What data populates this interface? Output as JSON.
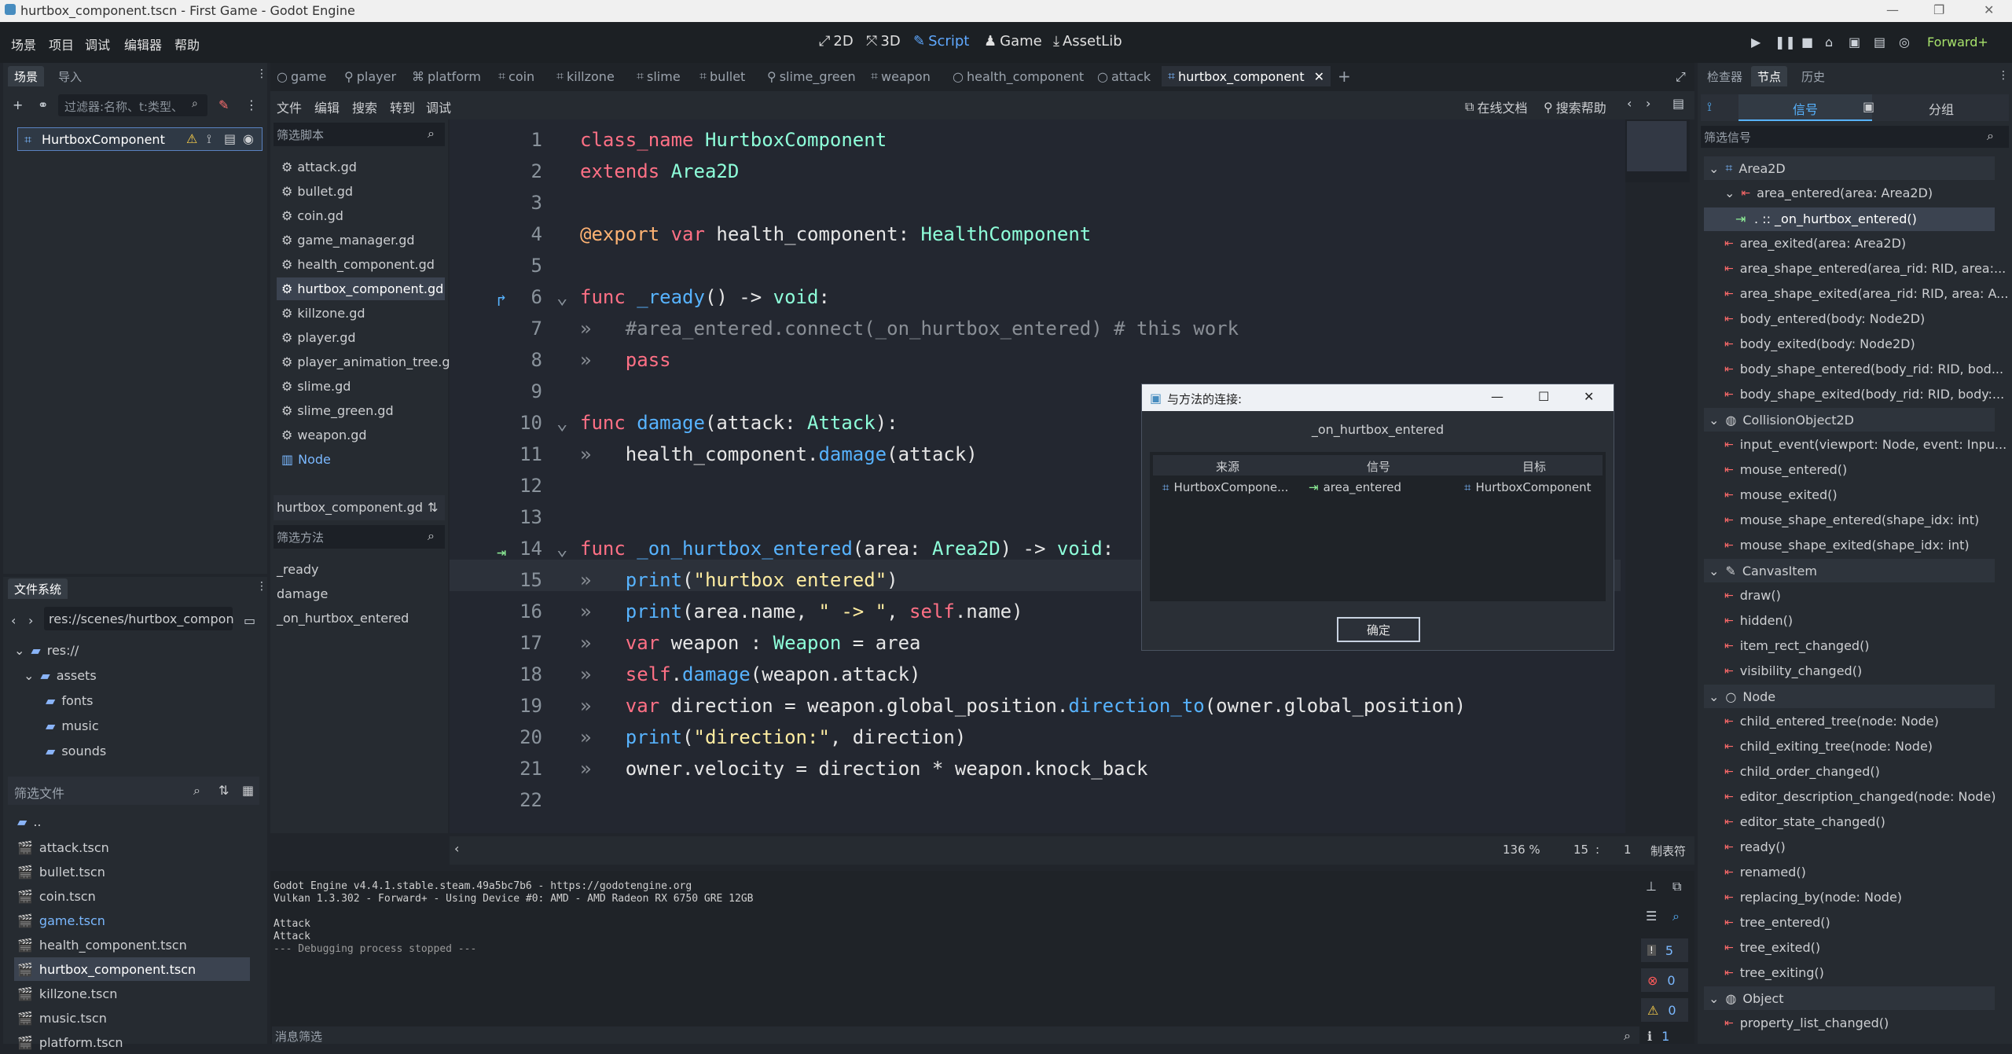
{
  "window": {
    "title": "hurtbox_component.tscn - First Game - Godot Engine"
  },
  "menu": [
    "场景",
    "项目",
    "调试",
    "编辑器",
    "帮助"
  ],
  "workspaces": {
    "w2d": "2D",
    "w3d": "3D",
    "script": "Script",
    "game": "Game",
    "assetlib": "AssetLib"
  },
  "renderer": "Forward+",
  "scene_dock": {
    "tabs": [
      "场景",
      "导入"
    ],
    "filter_placeholder": "过滤器:名称、t:类型、",
    "root_node": "HurtboxComponent"
  },
  "filesystem": {
    "tab": "文件系统",
    "path": "res://scenes/hurtbox_compon",
    "tree": {
      "root": "res://",
      "assets": "assets",
      "fonts": "fonts",
      "music": "music",
      "sounds": "sounds"
    },
    "filter_placeholder": "筛选文件",
    "files": [
      "..",
      "attack.tscn",
      "bullet.tscn",
      "coin.tscn",
      "game.tscn",
      "health_component.tscn",
      "hurtbox_component.tscn",
      "killzone.tscn",
      "music.tscn",
      "platform.tscn"
    ]
  },
  "editor_tabs": [
    "game",
    "player",
    "platform",
    "coin",
    "killzone",
    "slime",
    "bullet",
    "slime_green",
    "weapon",
    "health_component",
    "attack",
    "hurtbox_component"
  ],
  "script_menu": {
    "file": "文件",
    "edit": "编辑",
    "search": "搜索",
    "goto": "转到",
    "debug": "调试",
    "online_docs": "在线文档",
    "search_help": "搜索帮助"
  },
  "script_list": {
    "filter_placeholder": "筛选脚本",
    "items": [
      "attack.gd",
      "bullet.gd",
      "coin.gd",
      "game_manager.gd",
      "health_component.gd",
      "hurtbox_component.gd",
      "killzone.gd",
      "player.gd",
      "player_animation_tree.gd",
      "slime.gd",
      "slime_green.gd",
      "weapon.gd",
      "Node"
    ],
    "current": "hurtbox_component.gd",
    "method_filter": "筛选方法",
    "methods": [
      "_ready",
      "damage",
      "_on_hurtbox_entered"
    ]
  },
  "code": {
    "lines": [
      "1",
      "2",
      "3",
      "4",
      "5",
      "6",
      "7",
      "8",
      "9",
      "10",
      "11",
      "12",
      "13",
      "14",
      "15",
      "16",
      "17",
      "18",
      "19",
      "20",
      "21",
      "22"
    ]
  },
  "status": {
    "zoom": "136 %",
    "line": "15",
    "col": "1",
    "indent": "制表符"
  },
  "console": {
    "lines": [
      "Godot Engine v4.4.1.stable.steam.49a5bc7b6 - https://godotengine.org",
      "Vulkan 1.3.302 - Forward+ - Using Device #0: AMD - AMD Radeon RX 6750 GRE 12GB",
      "",
      "Attack",
      "Attack",
      "--- Debugging process stopped ---"
    ],
    "filter_placeholder": "消息筛选",
    "counts": {
      "messages": "5",
      "errors": "0",
      "warnings": "0",
      "info": "1"
    }
  },
  "dialog": {
    "title": "与方法的连接:",
    "method": "_on_hurtbox_entered",
    "columns": [
      "来源",
      "信号",
      "目标"
    ],
    "source": "HurtboxCompone...",
    "signal": "area_entered",
    "target": "HurtboxComponent",
    "ok": "确定"
  },
  "inspector": {
    "tabs": [
      "检查器",
      "节点",
      "历史"
    ],
    "subtabs": {
      "signals": "信号",
      "groups": "分组"
    },
    "filter_placeholder": "筛选信号"
  },
  "signals": {
    "area2d": "Area2D",
    "area2d_items": [
      "area_entered(area: Area2D)",
      "area_exited(area: Area2D)",
      "area_shape_entered(area_rid: RID, area:...",
      "area_shape_exited(area_rid: RID, area: A...",
      "body_entered(body: Node2D)",
      "body_exited(body: Node2D)",
      "body_shape_entered(body_rid: RID, bod...",
      "body_shape_exited(body_rid: RID, body:..."
    ],
    "connection": ". :: _on_hurtbox_entered()",
    "collision": "CollisionObject2D",
    "collision_items": [
      "input_event(viewport: Node, event: Inpu...",
      "mouse_entered()",
      "mouse_exited()",
      "mouse_shape_entered(shape_idx: int)",
      "mouse_shape_exited(shape_idx: int)"
    ],
    "canvas": "CanvasItem",
    "canvas_items": [
      "draw()",
      "hidden()",
      "item_rect_changed()",
      "visibility_changed()"
    ],
    "node": "Node",
    "node_items": [
      "child_entered_tree(node: Node)",
      "child_exiting_tree(node: Node)",
      "child_order_changed()",
      "editor_description_changed(node: Node)",
      "editor_state_changed()",
      "ready()",
      "renamed()",
      "replacing_by(node: Node)",
      "tree_entered()",
      "tree_exited()",
      "tree_exiting()"
    ],
    "object": "Object",
    "object_items": [
      "property_list_changed()"
    ]
  }
}
